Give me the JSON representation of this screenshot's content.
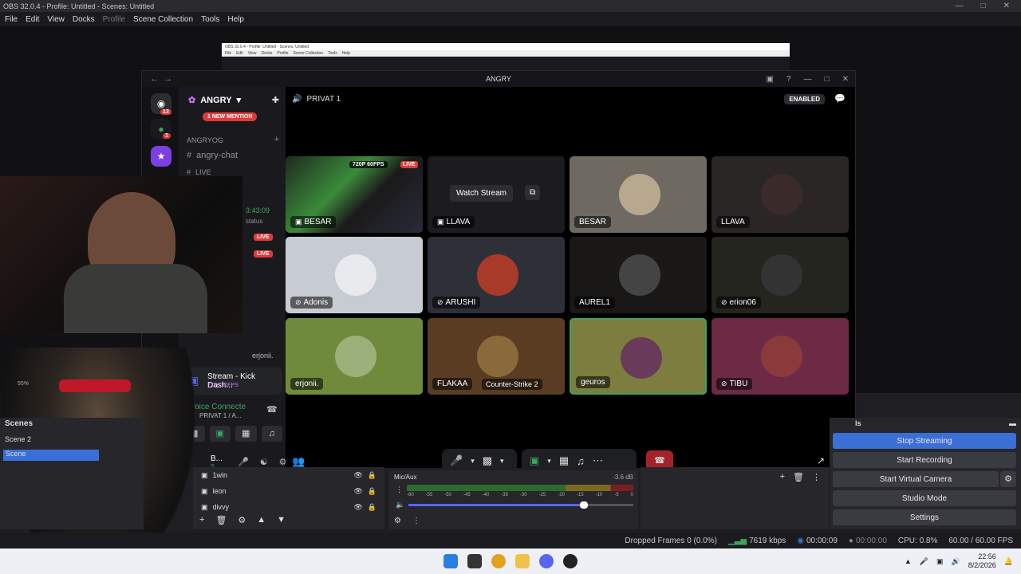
{
  "obs": {
    "title": "OBS 32.0.4 - Profile: Untitled - Scenes: Untitled",
    "menu": [
      "File",
      "Edit",
      "View",
      "Docks",
      "Profile",
      "Scene Collection",
      "Tools",
      "Help"
    ],
    "mini_title": "OBS 32.0.4 - Profile: Untitled - Scenes: Untitled",
    "mini_menu": [
      "File",
      "Edit",
      "View",
      "Docks",
      "Profile",
      "Scene Collection",
      "Tools",
      "Help"
    ]
  },
  "discord": {
    "window_title": "ANGRY",
    "server_name": "ANGRY",
    "mention_pill": "1 NEW MENTION",
    "category": "ANGRYOG",
    "channels": [
      "angry-chat",
      "LIVE"
    ],
    "timer": "3:43:09",
    "status_text": "status",
    "live_badge": "LIVE",
    "user_in_list": "erjonii.",
    "guild_badge_1": "13",
    "guild_badge_2": "1",
    "voice_channel": "PRIVAT 1",
    "enabled_label": "ENABLED",
    "stream_card_title": "Stream - Kick Dash...",
    "stream_card_sub": "720p 60FPS",
    "voice_connected": "Voice Connecte",
    "voice_sub": "PRIVAT 1 / A...",
    "user_short": "B...",
    "user_short_sub": "S...",
    "quality_badge": "720P 60FPS",
    "watch_stream": "Watch Stream",
    "tiles": [
      {
        "name": "BESAR",
        "icon": "screen-share-icon",
        "bg": "#222"
      },
      {
        "name": "LLAVA",
        "icon": "screen-share-icon",
        "bg": "#1c1c1f"
      },
      {
        "name": "BESAR",
        "icon": "",
        "bg": "#6e6a62"
      },
      {
        "name": "LLAVA",
        "icon": "",
        "bg": "#2b2626"
      },
      {
        "name": "Adonis",
        "icon": "video-off-icon",
        "bg": "#c7ccd3"
      },
      {
        "name": "ARUSHI",
        "icon": "video-off-icon",
        "bg": "#2e3038"
      },
      {
        "name": "AUREL1",
        "icon": "",
        "bg": "#1a1817"
      },
      {
        "name": "erion06",
        "icon": "video-off-icon",
        "bg": "#252520"
      },
      {
        "name": "erjonii.",
        "icon": "",
        "bg": "#6f8a3a"
      },
      {
        "name": "FLAKAA",
        "icon": "",
        "bg": "#5a3c22"
      },
      {
        "name": "geuros",
        "icon": "",
        "bg": "#7c7d3e"
      },
      {
        "name": "TIBU",
        "icon": "video-off-icon",
        "bg": "#6d2a45"
      }
    ],
    "flakaa_game": "Counter-Strike 2"
  },
  "scenes": {
    "header": "Scenes",
    "items": [
      "Scene 2",
      "Scene"
    ],
    "zoom": "55%"
  },
  "sources": {
    "items": [
      "1win",
      "leon",
      "divvy"
    ]
  },
  "mixer": {
    "label": "Mic/Aux",
    "db": "-3.6 dB",
    "ticks": [
      "-60",
      "-55",
      "-50",
      "-45",
      "-40",
      "-35",
      "-30",
      "-25",
      "-20",
      "-15",
      "-10",
      "-5",
      "0"
    ],
    "volume": 0.78
  },
  "controls": {
    "header": "ls",
    "buttons": [
      "Stop Streaming",
      "Start Recording",
      "Start Virtual Camera",
      "Studio Mode",
      "Settings"
    ]
  },
  "status": {
    "dropped": "Dropped Frames 0 (0.0%)",
    "kbps": "7619 kbps",
    "stream_time": "00:00:09",
    "rec_time": "00:00:00",
    "cpu": "CPU: 0.8%",
    "fps": "60.00 / 60.00 FPS"
  },
  "taskbar": {
    "time": "22:56",
    "date": "8/2/2026"
  },
  "colors": {
    "accent": "#5865f2",
    "live": "#e03b3b",
    "stop_streaming": "#3b6fd8"
  }
}
